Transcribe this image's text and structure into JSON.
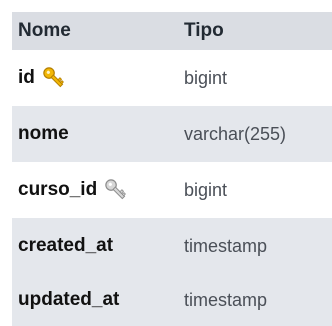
{
  "table": {
    "headers": {
      "name": "Nome",
      "type": "Tipo"
    },
    "rows": [
      {
        "name": "id",
        "type": "bigint",
        "icon": "primary-key-icon",
        "icon_color": "#f0b400"
      },
      {
        "name": "nome",
        "type": "varchar(255)"
      },
      {
        "name": "curso_id",
        "type": "bigint",
        "icon": "foreign-key-icon",
        "icon_color": "#9a9a9a"
      },
      {
        "name": "created_at",
        "type": "timestamp"
      },
      {
        "name": "updated_at",
        "type": "timestamp"
      }
    ]
  },
  "colors": {
    "header_bg": "#dadde3",
    "stripe_bg": "#e4e7ec",
    "row_bg": "#ffffff",
    "primary_key": "#f0b400",
    "foreign_key": "#9a9a9a"
  }
}
